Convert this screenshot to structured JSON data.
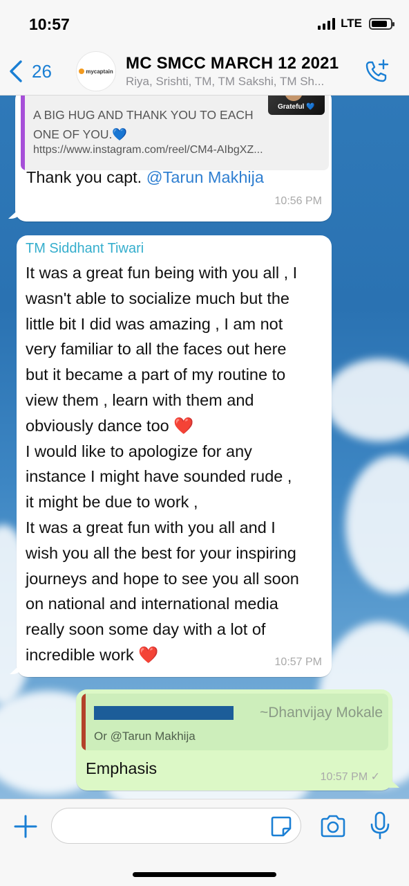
{
  "status": {
    "time": "10:57",
    "network": "LTE"
  },
  "header": {
    "back_count": "26",
    "avatar_brand": "mycaptain",
    "title": "MC SMCC MARCH 12 2021",
    "subtitle": "Riya, Srishti, TM, TM Sakshi, TM Sh..."
  },
  "messages": [
    {
      "quoted_text": "A BIG HUG AND THANK YOU TO EACH ONE OF YOU.💙",
      "quoted_link": "https://www.instagram.com/reel/CM4-AIbgXZ...",
      "quoted_thumb_label": "Grateful 💙",
      "text": "Thank you capt. ",
      "mention": "@Tarun Makhija",
      "time": "10:56 PM"
    },
    {
      "sender": "TM Siddhant Tiwari",
      "lines": [
        "It was a great fun being with you all , I",
        "wasn't able to socialize much but the",
        "little bit I did was amazing , I am not",
        "very familiar to all the faces out here",
        "but it became a part of my routine to",
        "view them , learn with them and",
        "obviously dance too ❤️",
        "I would like to apologize for any",
        "instance I might have sounded rude ,",
        "it might be due to work ,",
        "It was a great fun with you all and I",
        "wish you all the best for your inspiring",
        "journeys and hope to see you all soon",
        "on national and international media",
        "really soon some day with a lot of",
        "incredible work ❤️"
      ],
      "time": "10:57 PM"
    },
    {
      "reply_author": "~Dhanvijay Mokale",
      "reply_text": "Or ",
      "reply_mention": "@Tarun Makhija",
      "text": "Emphasis",
      "time": "10:57 PM ✓"
    }
  ],
  "input": {
    "placeholder": ""
  },
  "colors": {
    "accent": "#1a7fd4",
    "outgoing": "#dcf8c6",
    "sender": "#35aecd",
    "mention": "#2f7fd1"
  }
}
